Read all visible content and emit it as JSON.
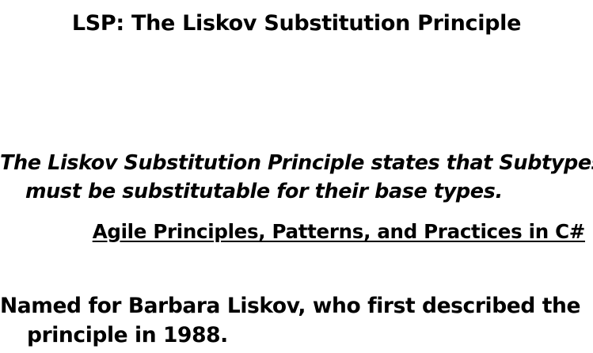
{
  "slide": {
    "title": "LSP: The Liskov Substitution Principle",
    "quote": {
      "line1": "The Liskov Substitution Principle states that Subtypes",
      "line2": "must be substitutable for their base types."
    },
    "source": "Agile Principles, Patterns, and Practices in C#",
    "note": {
      "line1": "Named for Barbara Liskov, who first described the",
      "line2": "principle in 1988."
    }
  }
}
